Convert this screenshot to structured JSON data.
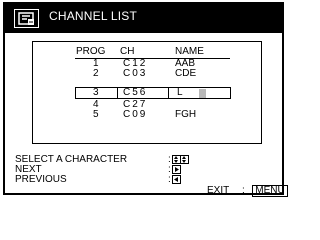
{
  "title": "CHANNEL LIST",
  "table": {
    "headers": [
      "PROG",
      "CH",
      "NAME"
    ],
    "rows": [
      {
        "prog": "1",
        "ch": "C12",
        "name": "AAB"
      },
      {
        "prog": "2",
        "ch": "C03",
        "name": "CDE"
      },
      {
        "prog": "3",
        "ch": "C56",
        "name": "L"
      },
      {
        "prog": "4",
        "ch": "C27",
        "name": ""
      },
      {
        "prog": "5",
        "ch": "C09",
        "name": "FGH"
      }
    ],
    "selected_row": 3
  },
  "instructions": [
    {
      "label": "SELECT A CHARACTER",
      "keys": [
        "up-down-arrow-icon"
      ]
    },
    {
      "label": "NEXT",
      "keys": [
        "right-arrow-icon"
      ]
    },
    {
      "label": "PREVIOUS",
      "keys": [
        "left-arrow-icon"
      ]
    }
  ],
  "exit": {
    "label": "EXIT",
    "key_label": "MENU"
  }
}
